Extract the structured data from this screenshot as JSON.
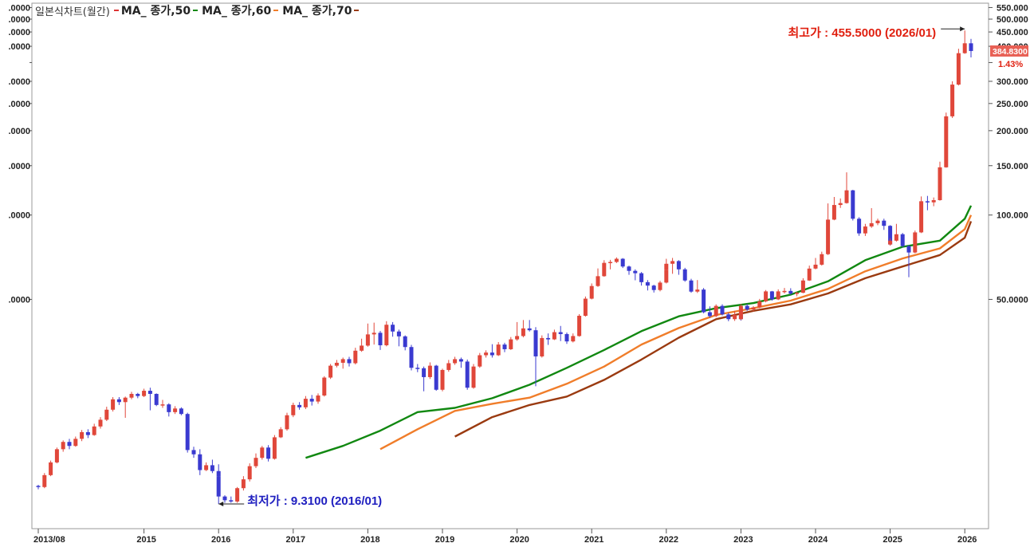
{
  "chart_data": {
    "type": "candlestick",
    "scale": "log",
    "chart_name": "일본식차트(월간)",
    "ylim": [
      7.6,
      570
    ],
    "x_start": "2013-08",
    "x_end": "2026-02",
    "x_ticks": [
      "2013/08",
      "2015",
      "2016",
      "2017",
      "2018",
      "2019",
      "2020",
      "2021",
      "2022",
      "2023",
      "2024",
      "2025",
      "2026"
    ],
    "y_ticks_right": [
      550,
      500,
      450,
      400,
      350,
      300,
      250,
      200,
      150,
      100,
      50
    ],
    "y_tick_labels_right": [
      "550.000",
      "500.000",
      "450.000",
      "400.000",
      "",
      "300.000",
      "250.000",
      "200.000",
      "150.000",
      "100.000",
      "50.0000"
    ],
    "y_tick_labels_left": [
      ".0000",
      ".0000",
      ".0000",
      ".0000",
      ".0000",
      ".0000",
      ".0000",
      ".0000",
      ".0000",
      ".0000",
      ".0000"
    ],
    "current_price_label": "384.8300",
    "current_change_label": "1.43%",
    "high_annotation": {
      "label": "최고가 : 455.5000 (2026/01)",
      "date": "2026-01",
      "value": 455.5
    },
    "low_annotation": {
      "label": "최저가 : 9.3100 (2016/01)",
      "date": "2016-01",
      "value": 9.31
    },
    "colors": {
      "up": "#e0473a",
      "down": "#3a3ad0",
      "ma50": "#118811",
      "ma60": "#f07d2a",
      "ma70": "#9a3a10",
      "high": "#e02010",
      "low": "#2020c0"
    },
    "series": [
      {
        "name": "MA_ 종가,50",
        "color": "#118811",
        "values": [
          [
            "2017-03",
            13.6
          ],
          [
            "2017-09",
            15.0
          ],
          [
            "2018-03",
            17.0
          ],
          [
            "2018-09",
            19.8
          ],
          [
            "2019-03",
            20.5
          ],
          [
            "2019-09",
            22.2
          ],
          [
            "2020-03",
            24.8
          ],
          [
            "2020-09",
            28.5
          ],
          [
            "2021-03",
            33.0
          ],
          [
            "2021-09",
            38.5
          ],
          [
            "2022-03",
            43.5
          ],
          [
            "2022-09",
            46.5
          ],
          [
            "2023-03",
            48.5
          ],
          [
            "2023-09",
            52.0
          ],
          [
            "2024-03",
            58.0
          ],
          [
            "2024-09",
            69.0
          ],
          [
            "2025-03",
            77.0
          ],
          [
            "2025-09",
            81.0
          ],
          [
            "2026-01",
            97.0
          ],
          [
            "2026-02",
            108.0
          ]
        ]
      },
      {
        "name": "MA_ 종가,60",
        "color": "#f07d2a",
        "values": [
          [
            "2018-03",
            14.6
          ],
          [
            "2018-09",
            17.2
          ],
          [
            "2019-03",
            20.0
          ],
          [
            "2019-09",
            21.2
          ],
          [
            "2020-03",
            22.3
          ],
          [
            "2020-09",
            25.0
          ],
          [
            "2021-03",
            28.8
          ],
          [
            "2021-09",
            34.5
          ],
          [
            "2022-03",
            39.5
          ],
          [
            "2022-09",
            44.0
          ],
          [
            "2023-03",
            46.5
          ],
          [
            "2023-09",
            49.5
          ],
          [
            "2024-03",
            54.5
          ],
          [
            "2024-09",
            63.0
          ],
          [
            "2025-03",
            70.0
          ],
          [
            "2025-09",
            76.0
          ],
          [
            "2026-01",
            89.0
          ],
          [
            "2026-02",
            100.0
          ]
        ]
      },
      {
        "name": "MA_ 종가,70",
        "color": "#9a3a10",
        "values": [
          [
            "2019-03",
            16.2
          ],
          [
            "2019-09",
            19.0
          ],
          [
            "2020-03",
            21.0
          ],
          [
            "2020-09",
            22.5
          ],
          [
            "2021-03",
            25.8
          ],
          [
            "2021-09",
            30.5
          ],
          [
            "2022-03",
            36.5
          ],
          [
            "2022-09",
            42.5
          ],
          [
            "2023-03",
            45.5
          ],
          [
            "2023-09",
            48.0
          ],
          [
            "2024-03",
            52.5
          ],
          [
            "2024-09",
            59.5
          ],
          [
            "2025-03",
            65.5
          ],
          [
            "2025-09",
            72.0
          ],
          [
            "2026-01",
            83.0
          ],
          [
            "2026-02",
            95.0
          ]
        ]
      }
    ],
    "candles": [
      [
        "2013-08",
        10.8,
        10.7,
        10.5,
        10.9
      ],
      [
        "2013-09",
        10.7,
        11.8,
        10.6,
        12.0
      ],
      [
        "2013-10",
        11.8,
        13.1,
        11.7,
        13.3
      ],
      [
        "2013-11",
        13.1,
        14.6,
        13.0,
        14.8
      ],
      [
        "2013-12",
        14.6,
        15.5,
        14.3,
        15.7
      ],
      [
        "2014-01",
        15.5,
        15.0,
        14.6,
        15.9
      ],
      [
        "2014-02",
        15.0,
        15.9,
        14.9,
        16.2
      ],
      [
        "2014-03",
        15.9,
        16.8,
        15.6,
        17.1
      ],
      [
        "2014-04",
        16.8,
        16.4,
        16.0,
        17.2
      ],
      [
        "2014-05",
        16.4,
        17.6,
        16.3,
        18.0
      ],
      [
        "2014-06",
        17.6,
        18.6,
        17.3,
        19.0
      ],
      [
        "2014-07",
        18.6,
        20.2,
        18.4,
        20.7
      ],
      [
        "2014-08",
        20.2,
        22.0,
        19.9,
        22.4
      ],
      [
        "2014-09",
        22.0,
        21.5,
        21.0,
        22.4
      ],
      [
        "2014-10",
        21.5,
        22.3,
        18.9,
        22.5
      ],
      [
        "2014-11",
        22.3,
        23.0,
        22.0,
        23.4
      ],
      [
        "2014-12",
        23.0,
        22.6,
        22.2,
        23.2
      ],
      [
        "2015-01",
        22.6,
        23.6,
        22.4,
        24.0
      ],
      [
        "2015-02",
        23.6,
        23.0,
        20.1,
        24.2
      ],
      [
        "2015-03",
        23.0,
        21.0,
        20.8,
        23.1
      ],
      [
        "2015-04",
        21.0,
        21.1,
        20.5,
        21.9
      ],
      [
        "2015-05",
        21.1,
        19.8,
        19.1,
        21.3
      ],
      [
        "2015-06",
        19.8,
        20.4,
        19.5,
        20.8
      ],
      [
        "2015-07",
        20.4,
        19.5,
        19.3,
        20.6
      ],
      [
        "2015-08",
        19.5,
        14.5,
        14.2,
        19.7
      ],
      [
        "2015-09",
        14.5,
        14.0,
        13.6,
        14.9
      ],
      [
        "2015-10",
        14.0,
        12.3,
        11.8,
        14.6
      ],
      [
        "2015-11",
        12.3,
        12.8,
        12.2,
        13.1
      ],
      [
        "2015-12",
        12.8,
        12.2,
        12.0,
        13.4
      ],
      [
        "2015-13",
        12.2,
        11.7,
        11.5,
        12.9
      ],
      [
        "2016-01",
        11.7,
        9.9,
        9.31,
        12.1
      ],
      [
        "2016-02",
        9.9,
        9.6,
        9.4,
        10.0
      ],
      [
        "2016-03",
        9.6,
        9.5,
        9.4,
        9.9
      ],
      [
        "2016-04",
        9.5,
        10.6,
        9.4,
        10.7
      ],
      [
        "2016-05",
        10.6,
        11.4,
        10.4,
        11.7
      ],
      [
        "2016-06",
        11.4,
        12.7,
        11.2,
        13.0
      ],
      [
        "2016-07",
        12.7,
        13.6,
        12.5,
        14.1
      ],
      [
        "2016-08",
        13.6,
        14.8,
        13.4,
        15.0
      ],
      [
        "2016-09",
        14.8,
        13.5,
        13.2,
        15.1
      ],
      [
        "2016-10",
        13.5,
        16.1,
        13.4,
        16.4
      ],
      [
        "2016-11",
        16.1,
        17.2,
        16.0,
        17.5
      ],
      [
        "2016-12",
        17.2,
        19.3,
        17.0,
        19.7
      ],
      [
        "2017-01",
        19.3,
        21.0,
        19.0,
        21.4
      ],
      [
        "2017-02",
        21.0,
        20.6,
        20.2,
        21.5
      ],
      [
        "2017-03",
        20.6,
        22.1,
        20.3,
        22.6
      ],
      [
        "2017-04",
        22.1,
        21.6,
        20.9,
        22.8
      ],
      [
        "2017-05",
        21.6,
        22.7,
        21.2,
        23.1
      ],
      [
        "2017-06",
        22.7,
        26.3,
        22.5,
        26.6
      ],
      [
        "2017-07",
        26.3,
        29.0,
        26.0,
        29.4
      ],
      [
        "2017-08",
        29.0,
        29.7,
        28.6,
        30.4
      ],
      [
        "2017-09",
        29.7,
        30.6,
        28.3,
        31.0
      ],
      [
        "2017-10",
        30.6,
        29.6,
        28.8,
        31.2
      ],
      [
        "2017-11",
        29.6,
        32.8,
        29.3,
        33.6
      ],
      [
        "2017-12",
        32.8,
        34.2,
        32.5,
        36.2
      ],
      [
        "2018-01",
        34.2,
        37.5,
        33.9,
        41.0
      ],
      [
        "2018-02",
        37.5,
        38.0,
        34.5,
        41.3
      ],
      [
        "2018-03",
        38.0,
        34.3,
        33.0,
        38.6
      ],
      [
        "2018-04",
        34.3,
        40.6,
        34.0,
        41.8
      ],
      [
        "2018-05",
        40.6,
        38.4,
        36.8,
        41.5
      ],
      [
        "2018-06",
        38.4,
        36.9,
        34.0,
        39.0
      ],
      [
        "2018-07",
        36.9,
        33.8,
        32.9,
        37.2
      ],
      [
        "2018-08",
        33.8,
        28.5,
        27.9,
        34.4
      ],
      [
        "2018-09",
        28.5,
        28.4,
        27.5,
        29.4
      ],
      [
        "2018-10",
        28.4,
        26.4,
        23.5,
        28.8
      ],
      [
        "2018-11",
        26.4,
        29.0,
        26.0,
        29.8
      ],
      [
        "2018-12",
        29.0,
        23.8,
        23.6,
        29.2
      ],
      [
        "2019-01",
        23.8,
        28.0,
        23.5,
        28.3
      ],
      [
        "2019-02",
        28.0,
        29.6,
        27.6,
        30.4
      ],
      [
        "2019-03",
        29.6,
        30.6,
        29.2,
        31.2
      ],
      [
        "2019-04",
        30.6,
        30.0,
        28.5,
        31.0
      ],
      [
        "2019-05",
        30.0,
        24.2,
        23.8,
        30.5
      ],
      [
        "2019-06",
        24.2,
        28.8,
        24.0,
        29.4
      ],
      [
        "2019-07",
        28.8,
        31.6,
        28.5,
        32.2
      ],
      [
        "2019-08",
        31.6,
        32.3,
        31.0,
        32.9
      ],
      [
        "2019-09",
        32.3,
        31.6,
        31.0,
        34.6
      ],
      [
        "2019-10",
        31.6,
        34.5,
        31.4,
        35.2
      ],
      [
        "2019-11",
        34.5,
        33.2,
        32.4,
        35.0
      ],
      [
        "2019-12",
        33.2,
        36.0,
        33.0,
        36.7
      ],
      [
        "2020-01",
        36.0,
        37.0,
        35.6,
        41.5
      ],
      [
        "2020-02",
        37.0,
        39.4,
        36.6,
        42.2
      ],
      [
        "2020-03",
        39.4,
        38.8,
        38.4,
        42.2
      ],
      [
        "2020-04",
        38.8,
        31.3,
        24.5,
        39.8
      ],
      [
        "2020-05",
        31.3,
        36.4,
        31.0,
        37.2
      ],
      [
        "2020-06",
        36.4,
        36.0,
        34.4,
        37.8
      ],
      [
        "2020-07",
        36.0,
        38.2,
        35.8,
        39.0
      ],
      [
        "2020-08",
        38.2,
        37.6,
        35.5,
        40.2
      ],
      [
        "2020-09",
        37.6,
        35.4,
        34.7,
        38.1
      ],
      [
        "2020-10",
        35.4,
        37.0,
        35.1,
        37.8
      ],
      [
        "2020-11",
        37.0,
        43.7,
        36.8,
        44.3
      ],
      [
        "2020-12",
        43.7,
        50.3,
        43.4,
        51.2
      ],
      [
        "2021-01",
        50.3,
        55.8,
        50.0,
        57.0
      ],
      [
        "2021-02",
        55.8,
        60.5,
        55.4,
        64.5
      ],
      [
        "2021-03",
        60.5,
        67.5,
        60.2,
        69.0
      ],
      [
        "2021-04",
        67.5,
        68.0,
        64.0,
        69.2
      ],
      [
        "2021-05",
        68.0,
        69.8,
        67.4,
        70.6
      ],
      [
        "2021-06",
        69.8,
        65.5,
        64.7,
        70.2
      ],
      [
        "2021-07",
        65.5,
        63.2,
        61.2,
        66.0
      ],
      [
        "2021-08",
        63.2,
        62.0,
        58.5,
        64.0
      ],
      [
        "2021-09",
        62.0,
        57.6,
        56.0,
        62.6
      ],
      [
        "2021-10",
        57.6,
        56.0,
        53.8,
        58.6
      ],
      [
        "2021-11",
        56.0,
        54.0,
        52.9,
        56.4
      ],
      [
        "2021-12",
        54.0,
        57.4,
        53.4,
        58.2
      ],
      [
        "2021-13",
        57.4,
        63.8,
        57.0,
        65.0
      ],
      [
        "2022-01",
        63.8,
        67.0,
        63.4,
        69.8
      ],
      [
        "2022-02",
        67.0,
        68.5,
        61.7,
        70.3
      ],
      [
        "2022-03",
        68.5,
        64.0,
        61.2,
        69.0
      ],
      [
        "2022-04",
        64.0,
        58.4,
        57.8,
        64.8
      ],
      [
        "2022-05",
        58.4,
        53.3,
        52.8,
        59.2
      ],
      [
        "2022-06",
        53.3,
        54.2,
        52.7,
        58.6
      ],
      [
        "2022-07",
        54.2,
        45.0,
        44.6,
        54.9
      ],
      [
        "2022-08",
        45.0,
        43.6,
        43.0,
        47.2
      ],
      [
        "2022-09",
        43.6,
        47.4,
        43.2,
        48.0
      ],
      [
        "2022-10",
        47.4,
        44.2,
        43.8,
        48.0
      ],
      [
        "2022-11",
        44.2,
        42.5,
        41.8,
        44.8
      ],
      [
        "2022-12",
        42.5,
        44.0,
        41.9,
        45.5
      ],
      [
        "2022-13",
        44.0,
        42.5,
        42.0,
        45.6
      ],
      [
        "2023-01",
        42.5,
        47.4,
        42.2,
        48.1
      ],
      [
        "2023-02",
        47.4,
        46.0,
        45.5,
        48.2
      ],
      [
        "2023-03",
        46.0,
        46.8,
        45.3,
        47.3
      ],
      [
        "2023-04",
        46.8,
        49.2,
        46.5,
        50.2
      ],
      [
        "2023-05",
        49.2,
        53.4,
        48.8,
        54.0
      ],
      [
        "2023-06",
        53.4,
        50.0,
        49.5,
        53.6
      ],
      [
        "2023-07",
        50.0,
        53.4,
        49.7,
        54.3
      ],
      [
        "2023-08",
        53.4,
        53.6,
        52.5,
        54.9
      ],
      [
        "2023-09",
        53.6,
        52.4,
        52.0,
        54.8
      ],
      [
        "2023-10",
        52.4,
        52.8,
        51.3,
        53.2
      ],
      [
        "2023-11",
        52.8,
        58.4,
        52.6,
        59.5
      ],
      [
        "2023-12",
        58.4,
        64.4,
        58.2,
        66.0
      ],
      [
        "2024-01",
        64.4,
        66.5,
        64.0,
        70.3
      ],
      [
        "2024-02",
        66.5,
        72.5,
        66.0,
        74.0
      ],
      [
        "2024-03",
        72.5,
        96.3,
        72.0,
        110.0
      ],
      [
        "2024-04",
        96.3,
        108.6,
        95.8,
        116.0
      ],
      [
        "2024-05",
        108.6,
        110.3,
        106.0,
        114.6
      ],
      [
        "2024-06",
        110.3,
        122.5,
        109.8,
        142.0
      ],
      [
        "2024-07",
        122.5,
        97.0,
        95.6,
        123.0
      ],
      [
        "2024-08",
        97.0,
        86.0,
        84.3,
        98.2
      ],
      [
        "2024-09",
        86.0,
        91.0,
        84.2,
        93.0
      ],
      [
        "2024-10",
        91.0,
        93.5,
        90.0,
        105.8
      ],
      [
        "2024-11",
        93.5,
        95.5,
        92.0,
        97.0
      ],
      [
        "2024-12",
        95.5,
        91.5,
        88.5,
        97.0
      ],
      [
        "2024-13",
        91.5,
        78.5,
        78.0,
        92.0
      ],
      [
        "2025-01",
        78.5,
        81.0,
        77.8,
        82.6
      ],
      [
        "2025-02",
        81.0,
        85.4,
        80.4,
        93.0
      ],
      [
        "2025-03",
        85.4,
        77.5,
        76.5,
        86.3
      ],
      [
        "2025-04",
        77.5,
        73.5,
        60.0,
        78.1
      ],
      [
        "2025-05",
        73.5,
        86.7,
        73.0,
        88.0
      ],
      [
        "2025-06",
        86.7,
        112.0,
        86.2,
        116.5
      ],
      [
        "2025-07",
        112.0,
        111.0,
        104.0,
        117.0
      ],
      [
        "2025-08",
        111.0,
        113.0,
        107.5,
        115.5
      ],
      [
        "2025-09",
        113.0,
        148.0,
        112.5,
        155.0
      ],
      [
        "2025-10",
        148.0,
        225.0,
        147.5,
        232.0
      ],
      [
        "2025-11",
        225.0,
        292.0,
        222.0,
        300.0
      ],
      [
        "2025-12",
        292.0,
        378.0,
        290.0,
        392.0
      ],
      [
        "2026-01",
        378.0,
        410.0,
        376.0,
        455.5
      ],
      [
        "2026-02",
        410.0,
        384.83,
        365.0,
        425.0
      ]
    ]
  }
}
